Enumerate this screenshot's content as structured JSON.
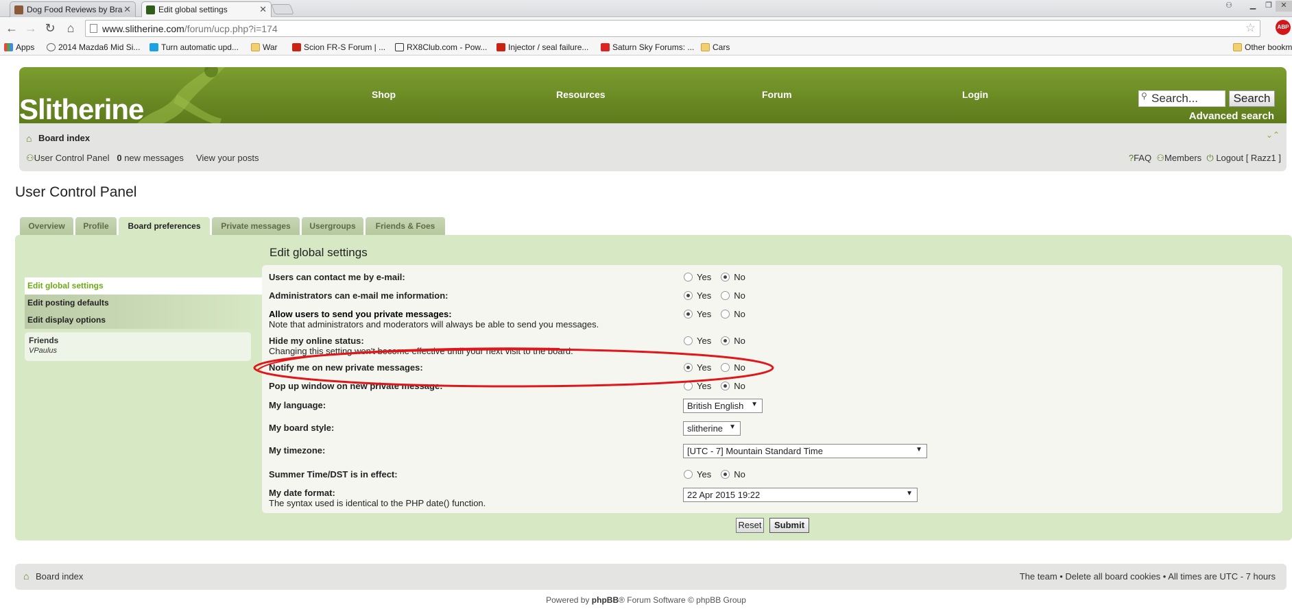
{
  "browser": {
    "tabs": [
      {
        "label": "Dog Food Reviews by Bra",
        "active": false
      },
      {
        "label": "Edit global settings",
        "active": true
      }
    ],
    "url_host": "www.slitherine.com",
    "url_path": "/forum/ucp.php?i=174",
    "abp_label": "ABP",
    "bookmarks": [
      {
        "label": "Apps",
        "icon": "apps-grid-icon"
      },
      {
        "label": "2014 Mazda6 Mid Si...",
        "icon": "mazda-icon"
      },
      {
        "label": "Turn automatic upd...",
        "icon": "windows-icon"
      },
      {
        "label": "War",
        "icon": "folder-icon"
      },
      {
        "label": "Scion FR-S Forum | ...",
        "icon": "forum-icon"
      },
      {
        "label": "RX8Club.com - Pow...",
        "icon": "rx8-icon"
      },
      {
        "label": "Injector / seal failure...",
        "icon": "forum-icon"
      },
      {
        "label": "Saturn Sky Forums: ...",
        "icon": "saturn-icon"
      },
      {
        "label": "Cars",
        "icon": "folder-icon"
      },
      {
        "label": "Other bookm",
        "icon": "folder-icon"
      }
    ]
  },
  "site": {
    "logo": "Slitherine",
    "nav": [
      "Shop",
      "Resources",
      "Forum",
      "Login"
    ],
    "search_placeholder": "Search...",
    "search_button": "Search",
    "advanced_search": "Advanced search",
    "brand_green": "#6b8b26"
  },
  "navbar": {
    "board_index": "Board index",
    "ucp_link": "User Control Panel",
    "new_messages_count": "0",
    "new_messages_label": "new messages",
    "view_posts": "View your posts",
    "faq": "FAQ",
    "members": "Members",
    "logout": "Logout [ Razz1 ]"
  },
  "ucp": {
    "title": "User Control Panel",
    "tabs": [
      "Overview",
      "Profile",
      "Board preferences",
      "Private messages",
      "Usergroups",
      "Friends & Foes"
    ],
    "active_tab": "Board preferences",
    "side_menu": [
      "Edit global settings",
      "Edit posting defaults",
      "Edit display options"
    ],
    "friends_heading": "Friends",
    "friends": [
      "VPaulus"
    ]
  },
  "form": {
    "title": "Edit global settings",
    "yes": "Yes",
    "no": "No",
    "rows": {
      "contact_email": {
        "label": "Users can contact me by e-mail:",
        "value": "No"
      },
      "admin_email": {
        "label": "Administrators can e-mail me information:",
        "value": "Yes"
      },
      "allow_pm": {
        "label": "Allow users to send you private messages:",
        "note": "Note that administrators and moderators will always be able to send you messages.",
        "value": "Yes"
      },
      "hide_online": {
        "label": "Hide my online status:",
        "note": "Changing this setting won't become effective until your next visit to the board.",
        "value": "No"
      },
      "notify_pm": {
        "label": "Notify me on new private messages:",
        "value": "Yes"
      },
      "popup_pm": {
        "label": "Pop up window on new private message:",
        "value": "No"
      },
      "language": {
        "label": "My language:",
        "value": "British English"
      },
      "style": {
        "label": "My board style:",
        "value": "slitherine"
      },
      "timezone": {
        "label": "My timezone:",
        "value": "[UTC - 7] Mountain Standard Time"
      },
      "dst": {
        "label": "Summer Time/DST is in effect:",
        "value": "No"
      },
      "date_format": {
        "label": "My date format:",
        "note": "The syntax used is identical to the PHP date() function.",
        "value": "22 Apr 2015 19:22"
      }
    },
    "reset": "Reset",
    "submit": "Submit"
  },
  "footer": {
    "board_index": "Board index",
    "right": "The team • Delete all board cookies • All times are UTC - 7 hours",
    "powered_prefix": "Powered by ",
    "powered_brand": "phpBB",
    "powered_suffix": "® Forum Software © phpBB Group"
  },
  "annotation_color": "#e0161b"
}
